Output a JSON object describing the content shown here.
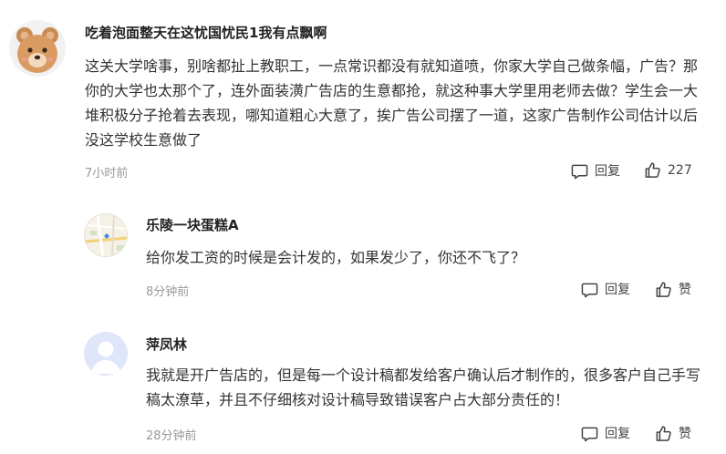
{
  "comments": [
    {
      "avatar": "bear-avatar",
      "username": "吃着泡面整天在这忧国忧民1我有点飘啊",
      "text": "这关大学啥事，别啥都扯上教职工，一点常识都没有就知道喷，你家大学自己做条幅，广告？那你的大学也太那个了，连外面装潢广告店的生意都抢，就这种事大学里用老师去做？学生会一大堆积极分子抢着去表现，哪知道粗心大意了，挨广告公司摆了一道，这家广告制作公司估计以后没这学校生意做了",
      "time": "7小时前",
      "reply_label": "回复",
      "like_label": "227"
    },
    {
      "avatar": "map-avatar",
      "username": "乐陵一块蛋糕A",
      "text": "给你发工资的时候是会计发的，如果发少了，你还不飞了？",
      "time": "8分钟前",
      "reply_label": "回复",
      "like_label": "赞"
    },
    {
      "avatar": "default-user-avatar",
      "username": "萍凤林",
      "text": "我就是开广告店的，但是每一个设计稿都发给客户确认后才制作的，很多客户自己手写稿太潦草，并且不仔细核对设计稿导致错误客户占大部分责任的！",
      "time": "28分钟前",
      "reply_label": "回复",
      "like_label": "赞"
    }
  ]
}
